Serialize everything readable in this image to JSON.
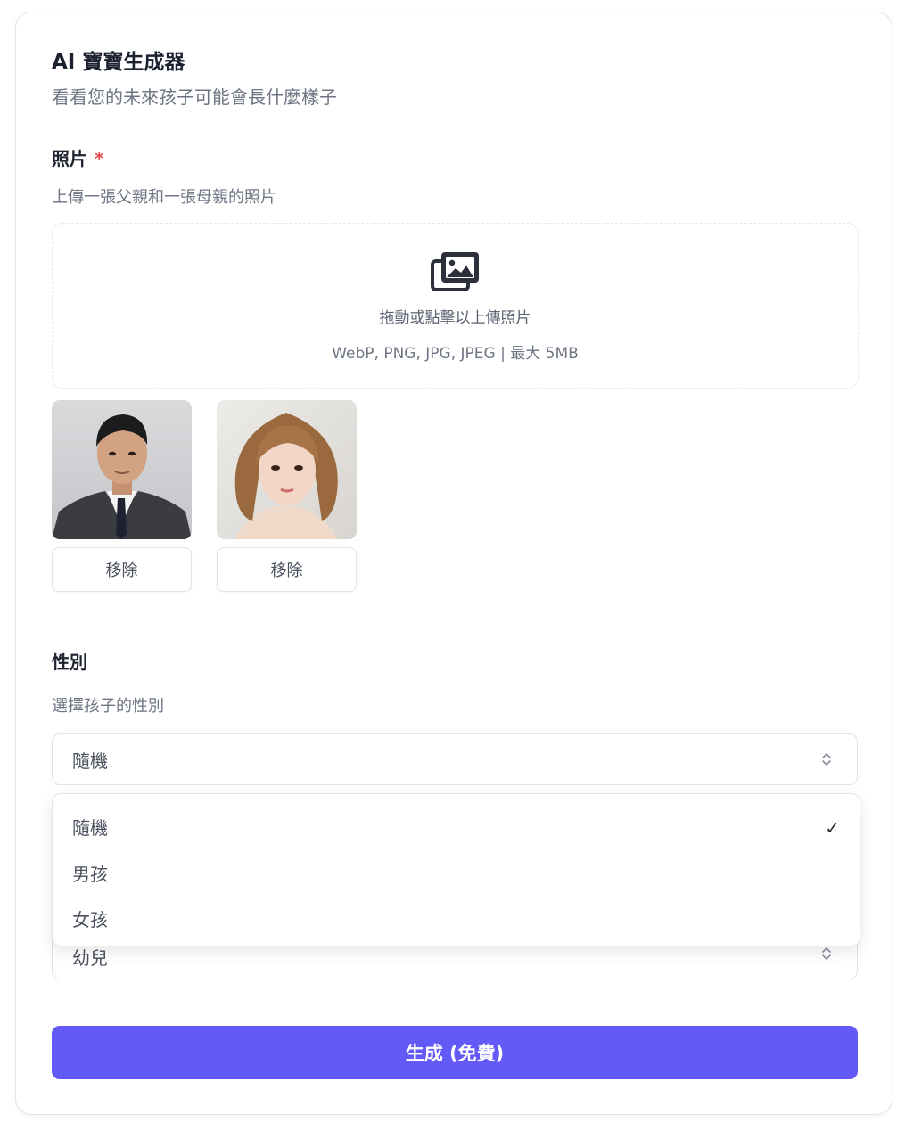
{
  "header": {
    "title": "AI 寶寶生成器",
    "subtitle": "看看您的未來孩子可能會長什麼樣子"
  },
  "photos": {
    "label": "照片",
    "required_mark": "*",
    "hint": "上傳一張父親和一張母親的照片",
    "dropzone_text": "拖動或點擊以上傳照片",
    "dropzone_formats": "WebP, PNG, JPG, JPEG | 最大 5MB",
    "dropzone_icon": "images-icon",
    "uploaded": [
      {
        "alt": "father photo",
        "remove_label": "移除"
      },
      {
        "alt": "mother photo",
        "remove_label": "移除"
      }
    ]
  },
  "gender": {
    "label": "性別",
    "hint": "選擇孩子的性別",
    "selected": "隨機",
    "options": [
      "隨機",
      "男孩",
      "女孩"
    ],
    "checked_option": "隨機"
  },
  "age": {
    "selected": "幼兒"
  },
  "submit": {
    "label": "生成 (免費)",
    "color": "#6259f7"
  }
}
